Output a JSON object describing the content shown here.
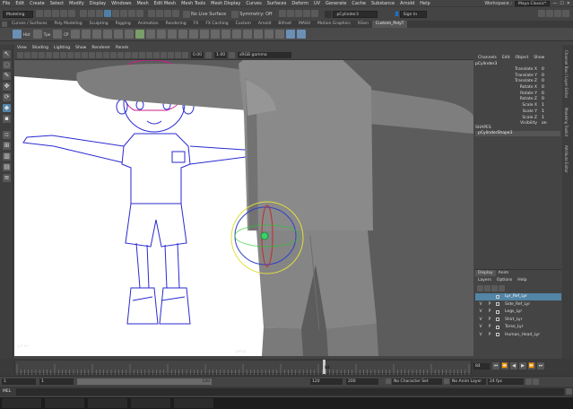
{
  "menubar": {
    "items": [
      "File",
      "Edit",
      "Create",
      "Select",
      "Modify",
      "Display",
      "Windows",
      "Mesh",
      "Edit Mesh",
      "Mesh Tools",
      "Mesh Display",
      "Curves",
      "Surfaces",
      "Deform",
      "UV",
      "Generate",
      "Cache",
      "Substance",
      "Arnold",
      "Help"
    ],
    "workspace_label": "Workspace :",
    "workspace_value": "Maya Classic*"
  },
  "statusline": {
    "mode": "Modeling",
    "live_surface": "No Live Surface",
    "symmetry": "Symmetry: Off",
    "object_name": "pCylinder3",
    "sign_in": "Sign In"
  },
  "shelf": {
    "tabs": [
      "Curves / Surfaces",
      "Poly Modeling",
      "Sculpting",
      "Rigging",
      "Animation",
      "Rendering",
      "FX",
      "FX Caching",
      "Custom",
      "Arnold",
      "Bifrost",
      "MASH",
      "Motion Graphics",
      "XGen",
      "Custom_PolyT"
    ],
    "active_tab": 14,
    "icon_labels": [
      "Hist",
      "Tpe",
      "CP"
    ]
  },
  "viewport": {
    "menu": [
      "View",
      "Shading",
      "Lighting",
      "Show",
      "Renderer",
      "Panels"
    ],
    "fields": [
      "0.00",
      "1.00"
    ],
    "color_space": "sRGB gamma",
    "camera": "persp"
  },
  "channel_box": {
    "tabs": [
      "Channels",
      "Edit",
      "Object",
      "Show"
    ],
    "object": "pCylinder3",
    "channels": [
      {
        "name": "Translate X",
        "value": "0"
      },
      {
        "name": "Translate Y",
        "value": "0"
      },
      {
        "name": "Translate Z",
        "value": "0"
      },
      {
        "name": "Rotate X",
        "value": "0"
      },
      {
        "name": "Rotate Y",
        "value": "0"
      },
      {
        "name": "Rotate Z",
        "value": "0"
      },
      {
        "name": "Scale X",
        "value": "1"
      },
      {
        "name": "Scale Y",
        "value": "1"
      },
      {
        "name": "Scale Z",
        "value": "1"
      },
      {
        "name": "Visibility",
        "value": "on"
      }
    ],
    "shapes_header": "SHAPES",
    "shape": "pCylinderShape3"
  },
  "side_tabs": [
    "Channel Box / Layer Editor",
    "Modeling Toolkit",
    "Attribute Editor"
  ],
  "layer_editor": {
    "tabs": [
      "Display",
      "Anim"
    ],
    "menu": [
      "Layers",
      "Options",
      "Help"
    ],
    "layers": [
      {
        "v": "",
        "p": "",
        "name": "Lyr_Ref_Lyr",
        "selected": true
      },
      {
        "v": "V",
        "p": "P",
        "name": "Side_Ref_Lyr",
        "selected": false
      },
      {
        "v": "V",
        "p": "P",
        "name": "Legs_Lyr",
        "selected": false
      },
      {
        "v": "V",
        "p": "P",
        "name": "Shirt_Lyr",
        "selected": false
      },
      {
        "v": "V",
        "p": "P",
        "name": "Torso_Lyr",
        "selected": false
      },
      {
        "v": "V",
        "p": "P",
        "name": "Human_Head_Lyr",
        "selected": false
      }
    ]
  },
  "timeline": {
    "current_frame": "84",
    "frame_field": "84",
    "range_start": "1",
    "range_start2": "1",
    "range_inner_end": "120",
    "range_end": "120",
    "range_max": "200",
    "character_set": "No Character Set",
    "anim_layer": "No Anim Layer",
    "fps": "24 fps"
  },
  "mel_label": "MEL",
  "colors": {
    "accent": "#5285a6",
    "viewport_bg": "#5c5c5c",
    "sketch_line": "#2a2ad0"
  }
}
